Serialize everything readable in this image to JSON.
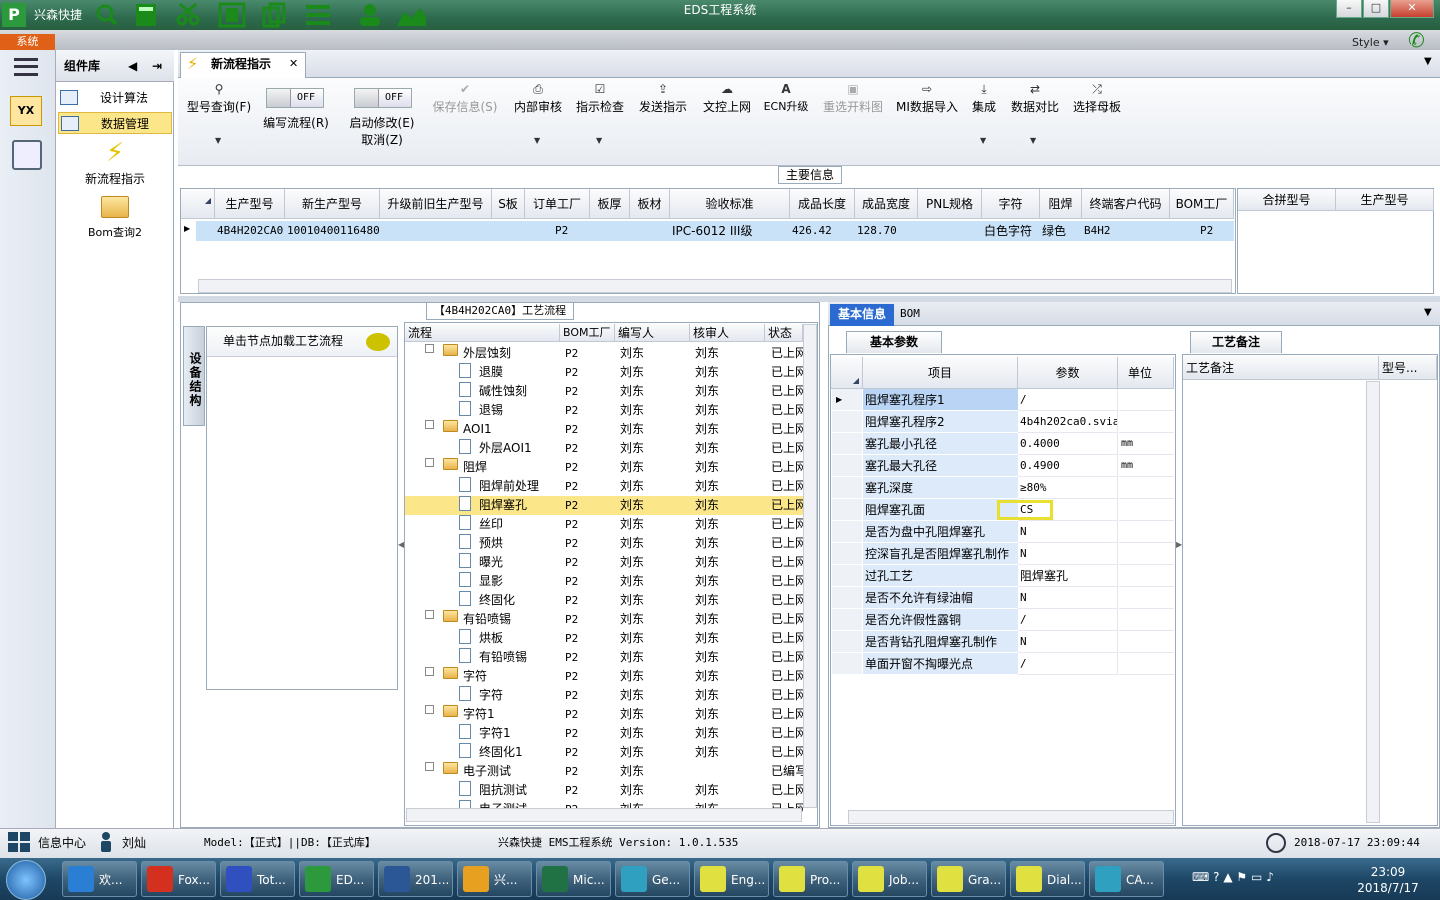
{
  "window": {
    "title": "EDS工程系统",
    "app_name": "兴森快捷",
    "style_label": "Style"
  },
  "top": {
    "system_tab": "系统"
  },
  "sidebar": {
    "header": "组件库",
    "items": [
      {
        "label": "设计算法",
        "icon": "form-icon"
      },
      {
        "label": "数据管理",
        "icon": "form-icon",
        "selected": true
      }
    ],
    "big_items": [
      {
        "label": "新流程指示",
        "icon": "lightning-icon"
      },
      {
        "label": "Bom查询2",
        "icon": "open-folder-icon"
      }
    ]
  },
  "doc_tab": {
    "label": "新流程指示"
  },
  "ribbon": {
    "buttons": [
      {
        "label": "型号查询(F)",
        "icon": "search-icon",
        "enabled": true
      },
      {
        "label": "编写流程(R)",
        "toggle": "OFF"
      },
      {
        "label": "启动修改(E)",
        "sub_label": "取消(Z)",
        "toggle": "OFF"
      },
      {
        "label": "保存信息(S)",
        "icon": "check-icon",
        "enabled": false
      },
      {
        "label": "内部审核",
        "icon": "print-icon",
        "enabled": true
      },
      {
        "label": "指示检查",
        "icon": "checkbox-icon",
        "enabled": true
      },
      {
        "label": "发送指示",
        "icon": "upload-icon",
        "enabled": true
      },
      {
        "label": "文控上网",
        "icon": "cloud-upload-icon",
        "enabled": true
      },
      {
        "label": "ECN升级",
        "icon": "ecn-icon",
        "enabled": true
      },
      {
        "label": "重选开料图",
        "icon": "image-icon",
        "enabled": false
      },
      {
        "label": "MI数据导入",
        "icon": "import-icon",
        "enabled": true
      },
      {
        "label": "集成",
        "icon": "download-icon",
        "enabled": true
      },
      {
        "label": "数据对比",
        "icon": "compare-icon",
        "enabled": true
      },
      {
        "label": "选择母板",
        "icon": "shuffle-icon",
        "enabled": true
      }
    ]
  },
  "main_info": {
    "title": "主要信息",
    "columns": [
      "生产型号",
      "新生产型号",
      "升级前旧生产型号",
      "S板",
      "订单工厂",
      "板厚",
      "板材",
      "验收标准",
      "成品长度",
      "成品宽度",
      "PNL规格",
      "字符",
      "阻焊",
      "终端客户代码",
      "BOM工厂"
    ],
    "row": [
      "4B4H202CA0",
      "10010400116480",
      "",
      "",
      "P2",
      "",
      "",
      "IPC-6012 III级",
      "426.42",
      "128.70",
      "",
      "白色字符",
      "绿色",
      "B4H2",
      "P2"
    ],
    "side_columns": [
      "合拼型号",
      "生产型号"
    ]
  },
  "process": {
    "title": "【4B4H202CA0】工艺流程",
    "vertical_tab": "设备结构",
    "node_hint": "单击节点加载工艺流程",
    "columns": [
      "流程",
      "BOM工厂",
      "编写人",
      "核审人",
      "状态"
    ],
    "rows": [
      {
        "name": "外层蚀刻",
        "level": 0,
        "bom": "P2",
        "author": "刘东",
        "reviewer": "刘东",
        "status": "已上网"
      },
      {
        "name": "退膜",
        "level": 1,
        "bom": "P2",
        "author": "刘东",
        "reviewer": "刘东",
        "status": "已上网"
      },
      {
        "name": "碱性蚀刻",
        "level": 1,
        "bom": "P2",
        "author": "刘东",
        "reviewer": "刘东",
        "status": "已上网"
      },
      {
        "name": "退锡",
        "level": 1,
        "bom": "P2",
        "author": "刘东",
        "reviewer": "刘东",
        "status": "已上网"
      },
      {
        "name": "AOI1",
        "level": 0,
        "bom": "P2",
        "author": "刘东",
        "reviewer": "刘东",
        "status": "已上网"
      },
      {
        "name": "外层AOI1",
        "level": 1,
        "bom": "P2",
        "author": "刘东",
        "reviewer": "刘东",
        "status": "已上网"
      },
      {
        "name": "阻焊",
        "level": 0,
        "bom": "P2",
        "author": "刘东",
        "reviewer": "刘东",
        "status": "已上网"
      },
      {
        "name": "阻焊前处理",
        "level": 1,
        "bom": "P2",
        "author": "刘东",
        "reviewer": "刘东",
        "status": "已上网"
      },
      {
        "name": "阻焊塞孔",
        "level": 1,
        "bom": "P2",
        "author": "刘东",
        "reviewer": "刘东",
        "status": "已上网",
        "selected": true
      },
      {
        "name": "丝印",
        "level": 1,
        "bom": "P2",
        "author": "刘东",
        "reviewer": "刘东",
        "status": "已上网"
      },
      {
        "name": "预烘",
        "level": 1,
        "bom": "P2",
        "author": "刘东",
        "reviewer": "刘东",
        "status": "已上网"
      },
      {
        "name": "曝光",
        "level": 1,
        "bom": "P2",
        "author": "刘东",
        "reviewer": "刘东",
        "status": "已上网"
      },
      {
        "name": "显影",
        "level": 1,
        "bom": "P2",
        "author": "刘东",
        "reviewer": "刘东",
        "status": "已上网"
      },
      {
        "name": "终固化",
        "level": 1,
        "bom": "P2",
        "author": "刘东",
        "reviewer": "刘东",
        "status": "已上网"
      },
      {
        "name": "有铅喷锡",
        "level": 0,
        "bom": "P2",
        "author": "刘东",
        "reviewer": "刘东",
        "status": "已上网"
      },
      {
        "name": "烘板",
        "level": 1,
        "bom": "P2",
        "author": "刘东",
        "reviewer": "刘东",
        "status": "已上网"
      },
      {
        "name": "有铅喷锡",
        "level": 1,
        "bom": "P2",
        "author": "刘东",
        "reviewer": "刘东",
        "status": "已上网"
      },
      {
        "name": "字符",
        "level": 0,
        "bom": "P2",
        "author": "刘东",
        "reviewer": "刘东",
        "status": "已上网"
      },
      {
        "name": "字符",
        "level": 1,
        "bom": "P2",
        "author": "刘东",
        "reviewer": "刘东",
        "status": "已上网"
      },
      {
        "name": "字符1",
        "level": 0,
        "bom": "P2",
        "author": "刘东",
        "reviewer": "刘东",
        "status": "已上网"
      },
      {
        "name": "字符1",
        "level": 1,
        "bom": "P2",
        "author": "刘东",
        "reviewer": "刘东",
        "status": "已上网"
      },
      {
        "name": "终固化1",
        "level": 1,
        "bom": "P2",
        "author": "刘东",
        "reviewer": "刘东",
        "status": "已上网"
      },
      {
        "name": "电子测试",
        "level": 0,
        "bom": "P2",
        "author": "刘东",
        "reviewer": "",
        "status": "已编写"
      },
      {
        "name": "阻抗测试",
        "level": 1,
        "bom": "P2",
        "author": "刘东",
        "reviewer": "刘东",
        "status": "已上网"
      },
      {
        "name": "电子测试",
        "level": 1,
        "bom": "P2",
        "author": "刘东",
        "reviewer": "刘东",
        "status": "已上网"
      }
    ]
  },
  "detail": {
    "tabs": [
      "基本信息",
      "BOM"
    ],
    "sub_tab": "基本参数",
    "columns": [
      "项目",
      "参数",
      "单位"
    ],
    "rows": [
      {
        "item": "阻焊塞孔程序1",
        "value": "/",
        "unit": ""
      },
      {
        "item": "阻焊塞孔程序2",
        "value": "4b4h202ca0.svia",
        "unit": ""
      },
      {
        "item": "塞孔最小孔径",
        "value": "0.4000",
        "unit": "mm"
      },
      {
        "item": "塞孔最大孔径",
        "value": "0.4900",
        "unit": "mm"
      },
      {
        "item": "塞孔深度",
        "value": "≥80%",
        "unit": ""
      },
      {
        "item": "阻焊塞孔面",
        "value": "CS",
        "unit": "",
        "highlight": true
      },
      {
        "item": "是否为盘中孔阻焊塞孔",
        "value": "N",
        "unit": ""
      },
      {
        "item": "控深盲孔是否阻焊塞孔制作",
        "value": "N",
        "unit": ""
      },
      {
        "item": "过孔工艺",
        "value": "阻焊塞孔",
        "unit": ""
      },
      {
        "item": "是否不允许有绿油帽",
        "value": "N",
        "unit": ""
      },
      {
        "item": "是否允许假性露铜",
        "value": "/",
        "unit": ""
      },
      {
        "item": "是否背钻孔阻焊塞孔制作",
        "value": "N",
        "unit": ""
      },
      {
        "item": "单面开窗不掏曝光点",
        "value": "/",
        "unit": ""
      }
    ]
  },
  "memo": {
    "tab": "工艺备注",
    "columns": [
      "工艺备注",
      "型号..."
    ]
  },
  "status": {
    "info_center": "信息中心",
    "user": "刘灿",
    "model": "Model:【正式】||DB:【正式库】",
    "system": "兴森快捷 EMS工程系统 Version: 1.0.1.535",
    "datetime": "2018-07-17 23:09:44"
  },
  "taskbar": {
    "items": [
      {
        "label": "欢...",
        "icon": "ie-icon",
        "color": "#2a7fd4"
      },
      {
        "label": "Fox...",
        "icon": "foxit-icon",
        "color": "#d43020"
      },
      {
        "label": "Tot...",
        "icon": "floppy-icon",
        "color": "#3050c0"
      },
      {
        "label": "ED...",
        "icon": "eds-icon",
        "color": "#2c9a3c"
      },
      {
        "label": "201...",
        "icon": "word-icon",
        "color": "#2b5797"
      },
      {
        "label": "兴...",
        "icon": "shell-icon",
        "color": "#e8a020"
      },
      {
        "label": "Mic...",
        "icon": "excel-icon",
        "color": "#207245"
      },
      {
        "label": "Ge...",
        "icon": "genesis-icon",
        "color": "#30a0c0"
      },
      {
        "label": "Eng...",
        "icon": "x-window-icon",
        "color": "#e0e040"
      },
      {
        "label": "Pro...",
        "icon": "x-window-icon",
        "color": "#e0e040"
      },
      {
        "label": "Job...",
        "icon": "x-window-icon",
        "color": "#e0e040"
      },
      {
        "label": "Gra...",
        "icon": "x-window-icon",
        "color": "#e0e040"
      },
      {
        "label": "Dial...",
        "icon": "x-window-icon",
        "color": "#e0e040"
      },
      {
        "label": "CA...",
        "icon": "genesis-icon",
        "color": "#30a0c0"
      }
    ],
    "clock_time": "23:09",
    "clock_date": "2018/7/17"
  },
  "colors": {
    "accent": "#2b6ad0",
    "title_bar": "#2d6a4e",
    "selection": "#fbe68a",
    "row_selected": "#c9e2f8",
    "highlight_box": "#e8e030"
  }
}
